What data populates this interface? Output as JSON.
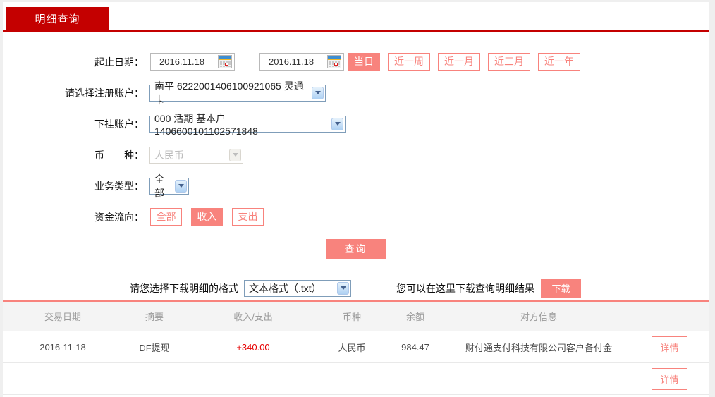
{
  "tab": {
    "label": "明细查询"
  },
  "form": {
    "date_range": {
      "label": "起止日期：",
      "start_value": "2016.11.18",
      "end_value": "2016.11.18",
      "separator": "—",
      "quick_buttons": [
        {
          "label": "当日",
          "active": true
        },
        {
          "label": "近一周",
          "active": false
        },
        {
          "label": "近一月",
          "active": false
        },
        {
          "label": "近三月",
          "active": false
        },
        {
          "label": "近一年",
          "active": false
        }
      ]
    },
    "register_account": {
      "label": "请选择注册账户：",
      "value": "南平 6222001406100921065 灵通卡"
    },
    "sub_account": {
      "label": "下挂账户：",
      "value": "000 活期 基本户 1406600101102571848"
    },
    "currency": {
      "label": "币　　种：",
      "value": "人民币",
      "disabled": true
    },
    "business_type": {
      "label": "业务类型：",
      "value": "全部"
    },
    "fund_flow": {
      "label": "资金流向：",
      "buttons": [
        {
          "label": "全部",
          "active": false
        },
        {
          "label": "收入",
          "active": true
        },
        {
          "label": "支出",
          "active": false
        }
      ]
    },
    "query_button": "查询"
  },
  "download": {
    "format_label": "请您选择下载明细的格式",
    "format_value": "文本格式（.txt）",
    "hint": "您可以在这里下载查询明细结果",
    "button": "下载"
  },
  "table": {
    "headers": [
      "交易日期",
      "摘要",
      "收入/支出",
      "币种",
      "余额",
      "对方信息"
    ],
    "action_label": "详情",
    "rows": [
      {
        "date": "2016-11-18",
        "summary": "DF提现",
        "amount": "+340.00",
        "currency": "人民币",
        "balance": "984.47",
        "counterparty": "财付通支付科技有限公司客户备付金",
        "action": "详情"
      }
    ]
  },
  "colors": {
    "brand_red": "#C40000",
    "accent_pink": "#F8837D",
    "amount_red": "#E60000",
    "header_bg": "#F4F4F4",
    "header_text": "#9B9B9B"
  }
}
